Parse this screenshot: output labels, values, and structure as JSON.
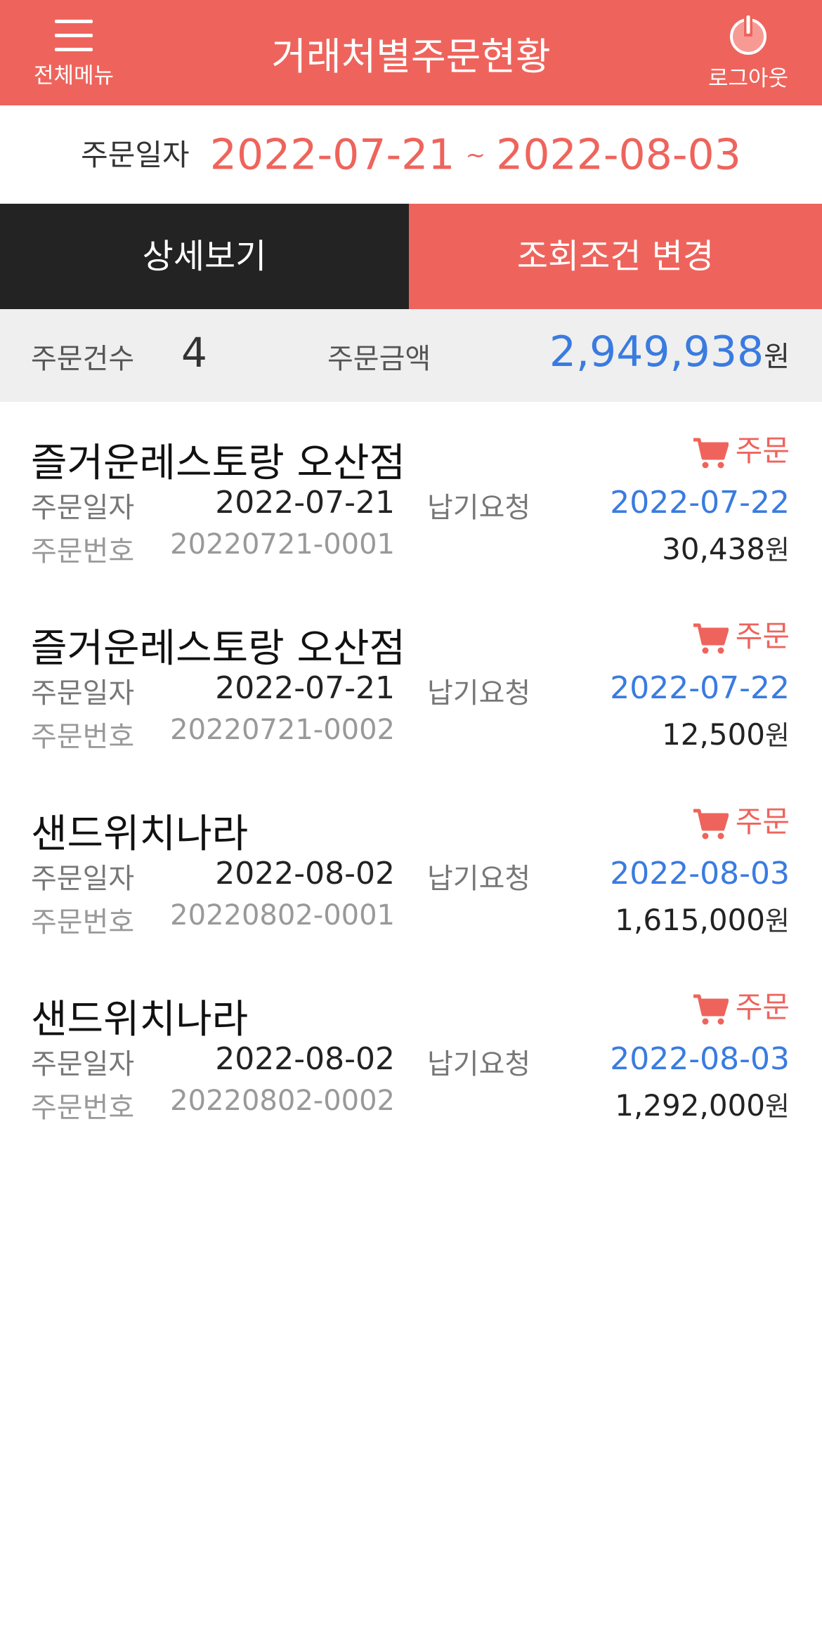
{
  "header": {
    "title": "거래처별주문현황",
    "menu_label": "전체메뉴",
    "logout_label": "로그아웃",
    "menu_icon": "hamburger-icon",
    "logout_icon": "power-icon",
    "color": "#ee645c"
  },
  "date_range": {
    "label": "주문일자",
    "start": "2022-07-21",
    "separator": "~",
    "end": "2022-08-03"
  },
  "actions": {
    "detail_label": "상세보기",
    "filter_label": "조회조건 변경"
  },
  "summary": {
    "count_label": "주문건수",
    "count": "4",
    "amount_label": "주문금액",
    "amount": "2,949,938",
    "unit": "원"
  },
  "labels": {
    "order_date": "주문일자",
    "order_no": "주문번호",
    "delivery_request": "납기요청",
    "status": "주문",
    "currency": "원"
  },
  "orders": [
    {
      "name": "즐거운레스토랑 오산점",
      "order_date": "2022-07-21",
      "order_no": "20220721-0001",
      "delivery_date": "2022-07-22",
      "amount": "30,438"
    },
    {
      "name": "즐거운레스토랑 오산점",
      "order_date": "2022-07-21",
      "order_no": "20220721-0002",
      "delivery_date": "2022-07-22",
      "amount": "12,500"
    },
    {
      "name": "샌드위치나라",
      "order_date": "2022-08-02",
      "order_no": "20220802-0001",
      "delivery_date": "2022-08-03",
      "amount": "1,615,000"
    },
    {
      "name": "샌드위치나라",
      "order_date": "2022-08-02",
      "order_no": "20220802-0002",
      "delivery_date": "2022-08-03",
      "amount": "1,292,000"
    }
  ],
  "colors": {
    "accent": "#ee645c",
    "dark": "#232323",
    "blue": "#3a7be0"
  }
}
